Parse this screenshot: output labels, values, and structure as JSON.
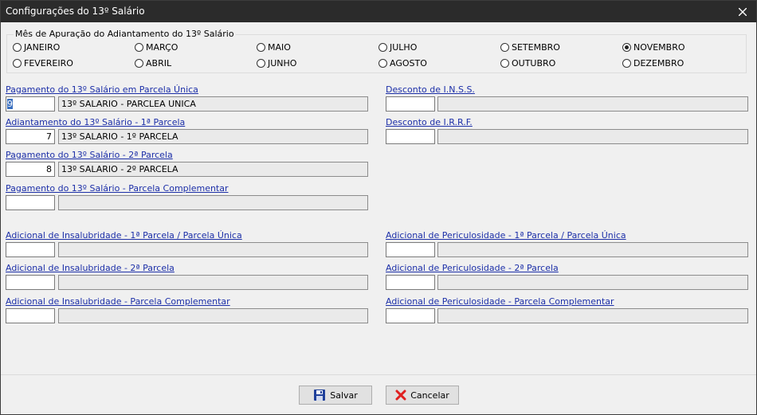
{
  "window": {
    "title": "Configurações do 13º Salário"
  },
  "months": {
    "group_label": "Mês de Apuração do Adiantamento do 13º Salário",
    "options": [
      "JANEIRO",
      "MARÇO",
      "MAIO",
      "JULHO",
      "SETEMBRO",
      "NOVEMBRO",
      "FEVEREIRO",
      "ABRIL",
      "JUNHO",
      "AGOSTO",
      "OUTUBRO",
      "DEZEMBRO"
    ],
    "selected": "NOVEMBRO"
  },
  "fields": {
    "pag_unica": {
      "label": "Pagamento do 13º Salário em Parcela Única",
      "code": "9",
      "desc": "13º SALARIO - PARCLEA UNICA"
    },
    "adiant_1": {
      "label": "Adiantamento do 13º Salário - 1ª Parcela",
      "code": "7",
      "desc": "13º SALARIO - 1º PARCELA"
    },
    "pag_2": {
      "label": "Pagamento do 13º Salário - 2ª Parcela",
      "code": "8",
      "desc": "13º SALARIO - 2º PARCELA"
    },
    "pag_comp": {
      "label": "Pagamento do 13º Salário - Parcela Complementar",
      "code": "",
      "desc": ""
    },
    "inss": {
      "label": "Desconto de I.N.S.S.",
      "code": "",
      "desc": ""
    },
    "irrf": {
      "label": "Desconto de I.R.R.F.",
      "code": "",
      "desc": ""
    },
    "insal_1": {
      "label": "Adicional de Insalubridade - 1ª Parcela / Parcela Única",
      "code": "",
      "desc": ""
    },
    "insal_2": {
      "label": "Adicional de Insalubridade - 2ª Parcela",
      "code": "",
      "desc": ""
    },
    "insal_comp": {
      "label": "Adicional de Insalubridade - Parcela Complementar",
      "code": "",
      "desc": ""
    },
    "peric_1": {
      "label": "Adicional de Periculosidade - 1ª Parcela / Parcela Única",
      "code": "",
      "desc": ""
    },
    "peric_2": {
      "label": "Adicional de Periculosidade - 2ª Parcela",
      "code": "",
      "desc": ""
    },
    "peric_comp": {
      "label": "Adicional de Periculosidade - Parcela Complementar",
      "code": "",
      "desc": ""
    }
  },
  "buttons": {
    "save": "Salvar",
    "cancel": "Cancelar"
  },
  "icons": {
    "save": "floppy-disk-icon",
    "cancel": "red-x-icon",
    "close": "close-icon"
  },
  "colors": {
    "titlebar": "#2b2b2b",
    "link": "#1c2fa8",
    "selection": "#3a6fbf",
    "cancel_x": "#e02020"
  }
}
